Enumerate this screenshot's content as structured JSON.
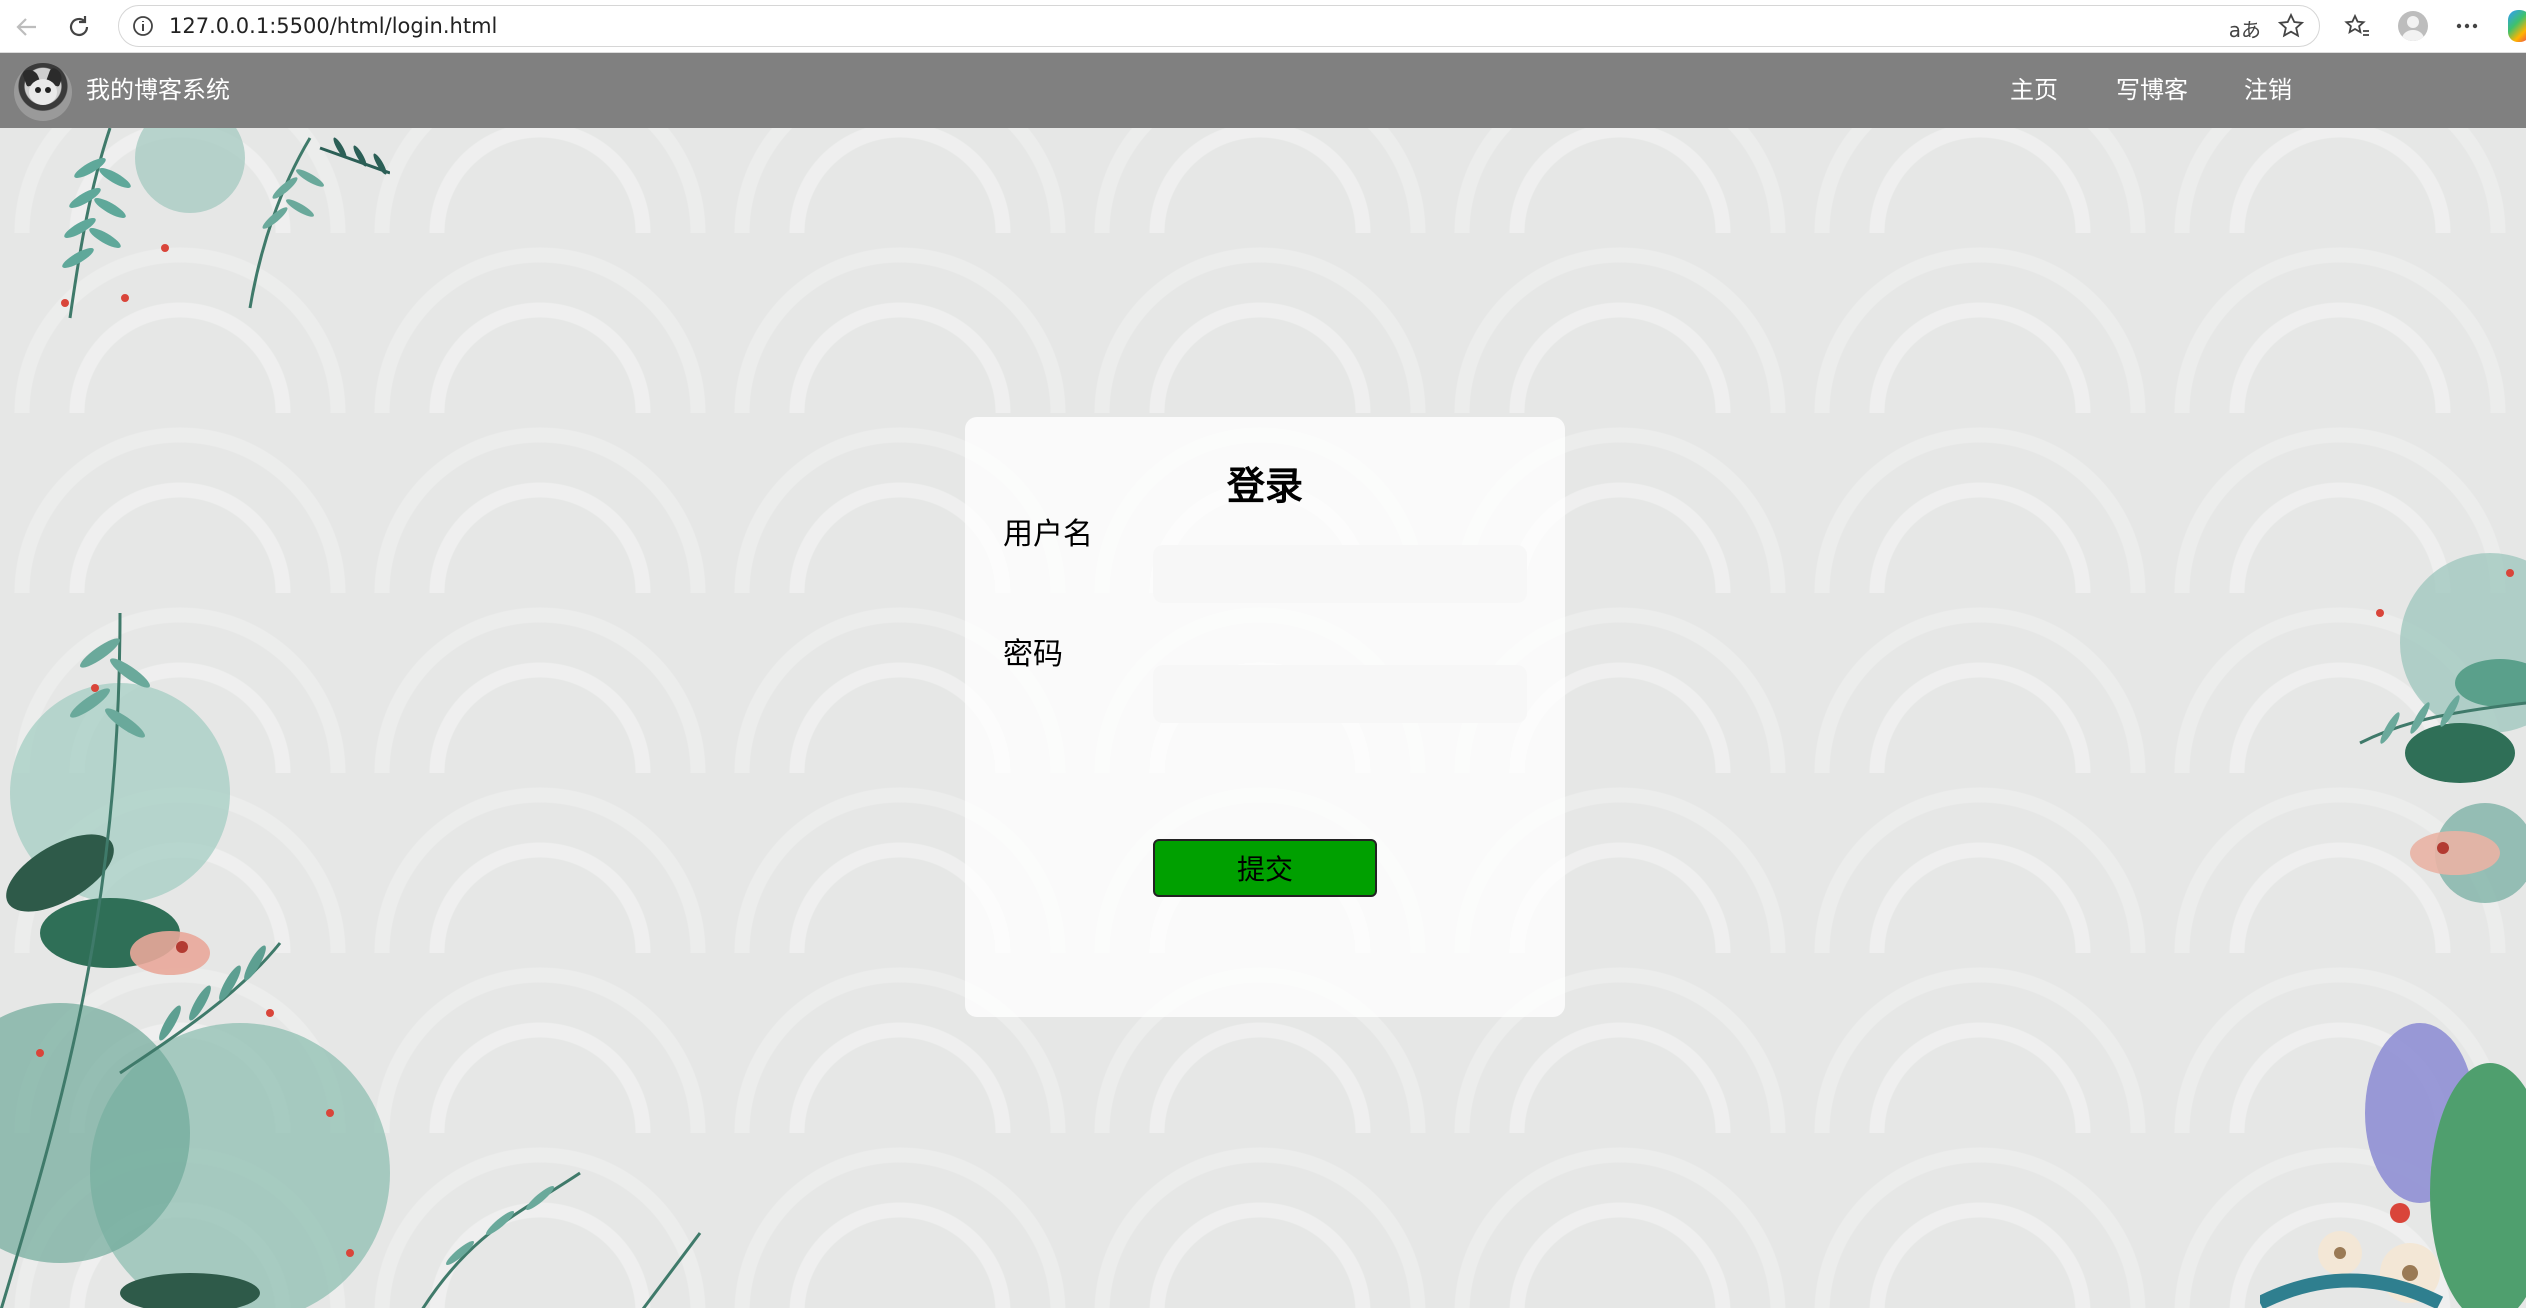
{
  "browser": {
    "url": "127.0.0.1:5500/html/login.html",
    "read_aloud_label": "aあ",
    "icons": [
      "back-icon",
      "refresh-icon",
      "info-icon",
      "read-aloud-icon",
      "favorite-star-icon",
      "favorites-icon",
      "profile-icon",
      "more-icon",
      "copilot-icon"
    ]
  },
  "header": {
    "site_title": "我的博客系统",
    "nav": [
      {
        "label": "主页"
      },
      {
        "label": "写博客"
      },
      {
        "label": "注销"
      }
    ]
  },
  "login": {
    "title": "登录",
    "username_label": "用户名",
    "username_value": "",
    "password_label": "密码",
    "password_value": "",
    "submit_label": "提交"
  },
  "colors": {
    "nav_bg": "#808080",
    "button_bg": "#00a000",
    "page_bg": "#e6e7e6"
  }
}
